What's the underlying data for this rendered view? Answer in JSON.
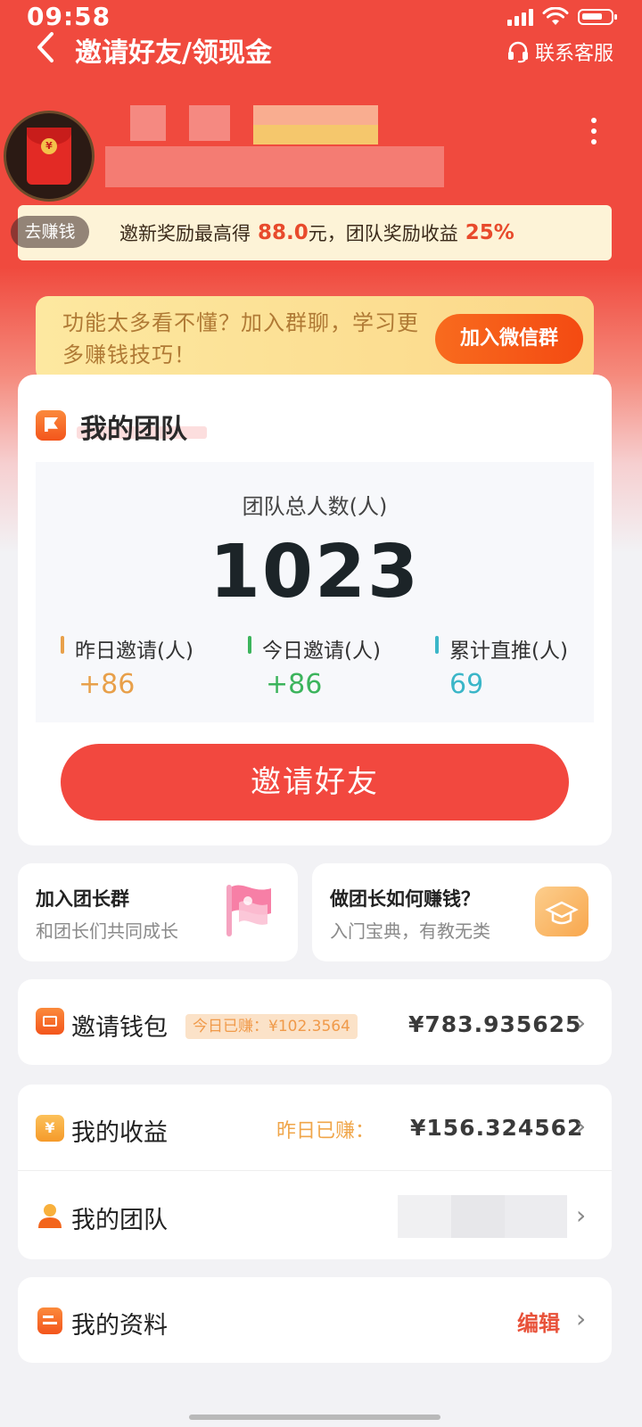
{
  "status": {
    "time": "09:58"
  },
  "nav": {
    "title": "邀请好友/领现金",
    "service_label": "联系客服"
  },
  "header": {
    "earn_pill": "去赚钱",
    "reward_prefix": "邀新奖励最高得",
    "reward_amount": "88.0",
    "reward_mid": "元，团队奖励收益",
    "reward_rate": "25%"
  },
  "wechat_banner": {
    "text": "功能太多看不懂？加入群聊，学习更多赚钱技巧！",
    "button": "加入微信群"
  },
  "team": {
    "title": "我的团队",
    "total_label": "团队总人数(人)",
    "total_value": "1023",
    "stats": [
      {
        "label": "昨日邀请(人)",
        "value": "+86",
        "color": "#e8a04a"
      },
      {
        "label": "今日邀请(人)",
        "value": "+86",
        "color": "#3cb45c"
      },
      {
        "label": "累计直推(人)",
        "value": "69",
        "color": "#3bb6c8"
      }
    ],
    "invite_button": "邀请好友"
  },
  "features": [
    {
      "title": "加入团长群",
      "subtitle": "和团长们共同成长",
      "icon": "flag-icon"
    },
    {
      "title": "做团长如何赚钱？",
      "subtitle": "入门宝典，有教无类",
      "icon": "graduation-cap-icon"
    }
  ],
  "wallet": {
    "label": "邀请钱包",
    "today_tag": "今日已赚：¥102.3564",
    "amount": "¥783.935625"
  },
  "earnings": {
    "label": "我的收益",
    "yesterday_label": "昨日已赚：",
    "amount": "¥156.324562"
  },
  "my_team": {
    "label": "我的团队"
  },
  "profile": {
    "label": "我的资料",
    "edit": "编辑"
  },
  "colors": {
    "brand_red": "#f04a3e",
    "button_red": "#f2483f",
    "accent_orange": "#f86b1e"
  }
}
